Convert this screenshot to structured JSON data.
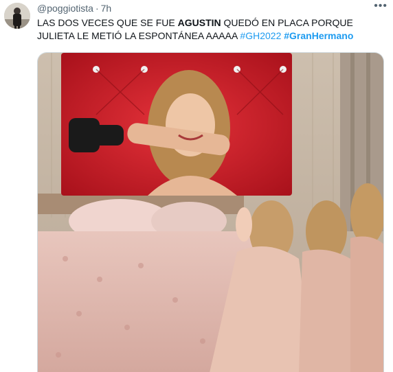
{
  "tweet": {
    "handle": "@poggiotista",
    "separator": "·",
    "time": "7h",
    "more_icon": "more-dots-icon",
    "text": {
      "part1": "LAS DOS VECES QUE SE FUE ",
      "bold_name": "AGUSTIN",
      "part2": " QUEDÓ EN PLACA PORQUE JULIETA LE METIÓ LA ESPONTÁNEA AAAAA ",
      "hashtag1": "#GH2022",
      "hashtag2": "#GranHermano"
    },
    "colors": {
      "hashtag": "#1d9bf0",
      "text": "#0f1419",
      "muted": "#536471"
    }
  }
}
